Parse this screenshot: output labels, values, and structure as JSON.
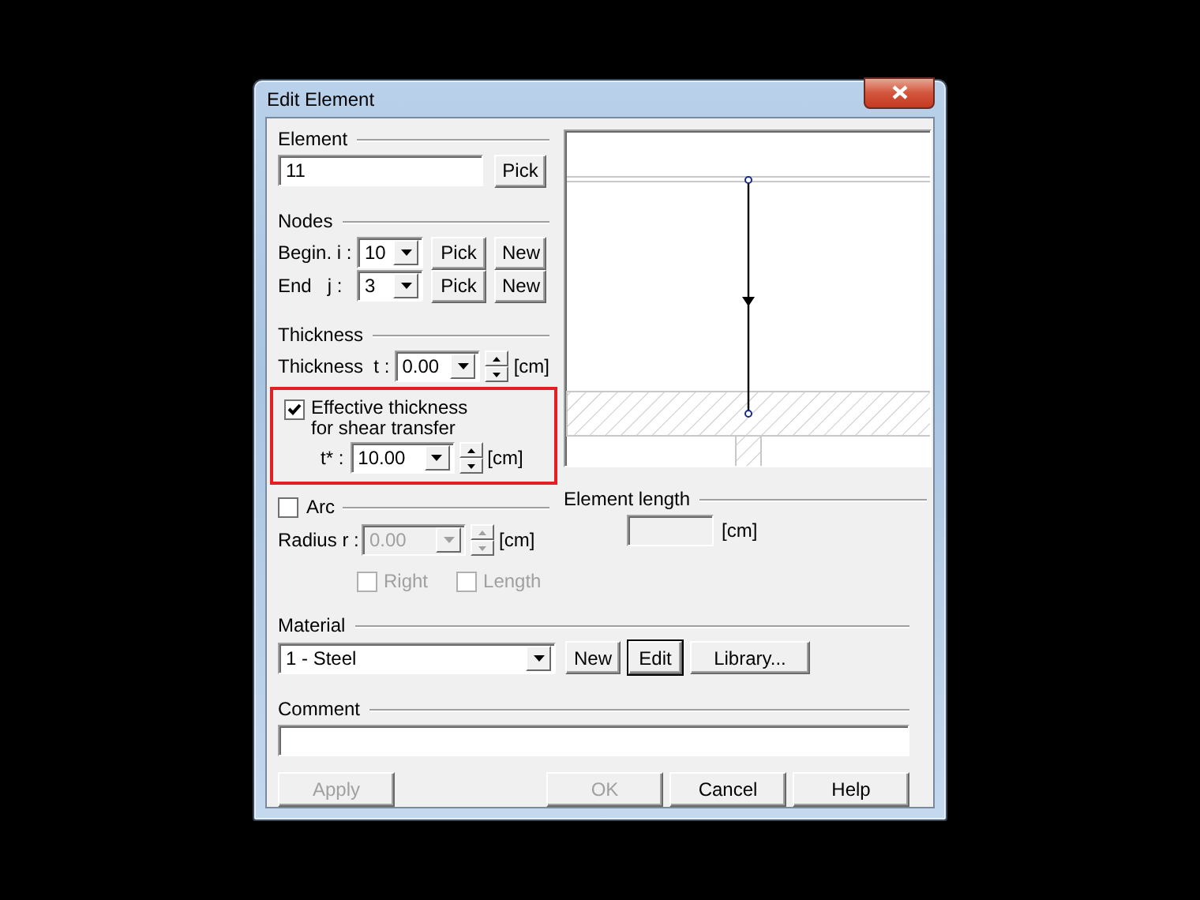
{
  "window": {
    "title": "Edit Element"
  },
  "element_group": {
    "label": "Element",
    "value": "11",
    "button": "Pick"
  },
  "nodes_group": {
    "label": "Nodes",
    "rows": [
      {
        "label": "Begin. i :",
        "value": "10",
        "buttons": [
          "Pick",
          "New"
        ]
      },
      {
        "label": "End   j :",
        "value": "3",
        "buttons": [
          "Pick",
          "New"
        ]
      }
    ]
  },
  "thickness_group": {
    "label": "Thickness",
    "field_label": "Thickness  t :",
    "value": "0.00",
    "unit": "[cm]"
  },
  "effective": {
    "checked": true,
    "highlighted": true,
    "label_lines": [
      "Effective thickness",
      "for shear transfer"
    ],
    "field_label": "t* :",
    "value": "10.00",
    "unit": "[cm]"
  },
  "arc": {
    "label": "Arc",
    "checked": false,
    "disabled": true,
    "field_label": "Radius r :",
    "value": "0.00",
    "unit": "[cm]",
    "options": [
      {
        "label": "Right",
        "checked": false,
        "disabled": true
      },
      {
        "label": "Length",
        "checked": false,
        "disabled": true
      }
    ]
  },
  "element_length": {
    "label": "Element length",
    "unit": "[cm]"
  },
  "material_group": {
    "label": "Material",
    "value": "1 - Steel",
    "buttons": [
      {
        "label": "New",
        "focused": false
      },
      {
        "label": "Edit",
        "focused": true
      },
      {
        "label": "Library...",
        "focused": false
      }
    ]
  },
  "comment_group": {
    "label": "Comment"
  },
  "left_buttons": [
    {
      "label": "Apply",
      "disabled": true
    }
  ],
  "right_buttons": [
    {
      "label": "OK",
      "disabled": true
    },
    {
      "label": "Cancel",
      "disabled": false
    },
    {
      "label": "Help",
      "disabled": false
    }
  ]
}
